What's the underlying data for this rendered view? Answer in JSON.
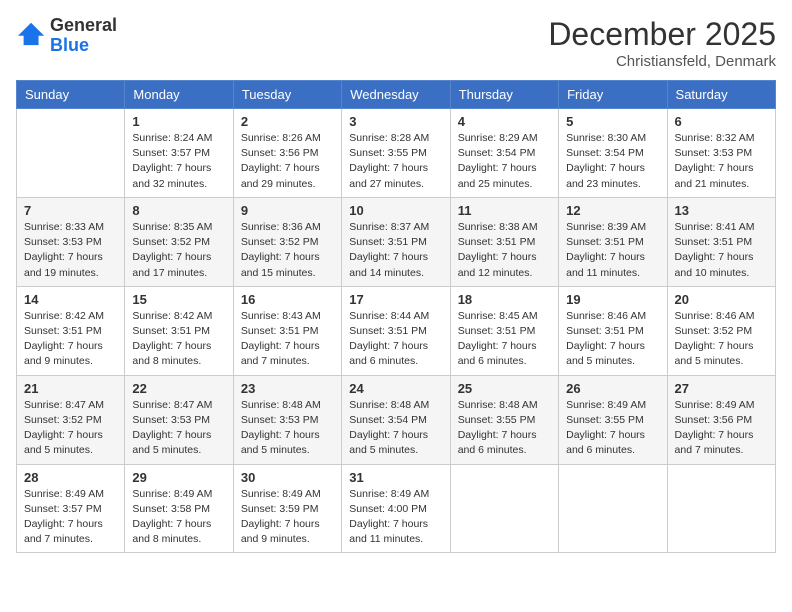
{
  "logo": {
    "general": "General",
    "blue": "Blue"
  },
  "title": "December 2025",
  "subtitle": "Christiansfeld, Denmark",
  "days_of_week": [
    "Sunday",
    "Monday",
    "Tuesday",
    "Wednesday",
    "Thursday",
    "Friday",
    "Saturday"
  ],
  "weeks": [
    [
      {
        "day": "",
        "info": ""
      },
      {
        "day": "1",
        "info": "Sunrise: 8:24 AM\nSunset: 3:57 PM\nDaylight: 7 hours\nand 32 minutes."
      },
      {
        "day": "2",
        "info": "Sunrise: 8:26 AM\nSunset: 3:56 PM\nDaylight: 7 hours\nand 29 minutes."
      },
      {
        "day": "3",
        "info": "Sunrise: 8:28 AM\nSunset: 3:55 PM\nDaylight: 7 hours\nand 27 minutes."
      },
      {
        "day": "4",
        "info": "Sunrise: 8:29 AM\nSunset: 3:54 PM\nDaylight: 7 hours\nand 25 minutes."
      },
      {
        "day": "5",
        "info": "Sunrise: 8:30 AM\nSunset: 3:54 PM\nDaylight: 7 hours\nand 23 minutes."
      },
      {
        "day": "6",
        "info": "Sunrise: 8:32 AM\nSunset: 3:53 PM\nDaylight: 7 hours\nand 21 minutes."
      }
    ],
    [
      {
        "day": "7",
        "info": "Sunrise: 8:33 AM\nSunset: 3:53 PM\nDaylight: 7 hours\nand 19 minutes."
      },
      {
        "day": "8",
        "info": "Sunrise: 8:35 AM\nSunset: 3:52 PM\nDaylight: 7 hours\nand 17 minutes."
      },
      {
        "day": "9",
        "info": "Sunrise: 8:36 AM\nSunset: 3:52 PM\nDaylight: 7 hours\nand 15 minutes."
      },
      {
        "day": "10",
        "info": "Sunrise: 8:37 AM\nSunset: 3:51 PM\nDaylight: 7 hours\nand 14 minutes."
      },
      {
        "day": "11",
        "info": "Sunrise: 8:38 AM\nSunset: 3:51 PM\nDaylight: 7 hours\nand 12 minutes."
      },
      {
        "day": "12",
        "info": "Sunrise: 8:39 AM\nSunset: 3:51 PM\nDaylight: 7 hours\nand 11 minutes."
      },
      {
        "day": "13",
        "info": "Sunrise: 8:41 AM\nSunset: 3:51 PM\nDaylight: 7 hours\nand 10 minutes."
      }
    ],
    [
      {
        "day": "14",
        "info": "Sunrise: 8:42 AM\nSunset: 3:51 PM\nDaylight: 7 hours\nand 9 minutes."
      },
      {
        "day": "15",
        "info": "Sunrise: 8:42 AM\nSunset: 3:51 PM\nDaylight: 7 hours\nand 8 minutes."
      },
      {
        "day": "16",
        "info": "Sunrise: 8:43 AM\nSunset: 3:51 PM\nDaylight: 7 hours\nand 7 minutes."
      },
      {
        "day": "17",
        "info": "Sunrise: 8:44 AM\nSunset: 3:51 PM\nDaylight: 7 hours\nand 6 minutes."
      },
      {
        "day": "18",
        "info": "Sunrise: 8:45 AM\nSunset: 3:51 PM\nDaylight: 7 hours\nand 6 minutes."
      },
      {
        "day": "19",
        "info": "Sunrise: 8:46 AM\nSunset: 3:51 PM\nDaylight: 7 hours\nand 5 minutes."
      },
      {
        "day": "20",
        "info": "Sunrise: 8:46 AM\nSunset: 3:52 PM\nDaylight: 7 hours\nand 5 minutes."
      }
    ],
    [
      {
        "day": "21",
        "info": "Sunrise: 8:47 AM\nSunset: 3:52 PM\nDaylight: 7 hours\nand 5 minutes."
      },
      {
        "day": "22",
        "info": "Sunrise: 8:47 AM\nSunset: 3:53 PM\nDaylight: 7 hours\nand 5 minutes."
      },
      {
        "day": "23",
        "info": "Sunrise: 8:48 AM\nSunset: 3:53 PM\nDaylight: 7 hours\nand 5 minutes."
      },
      {
        "day": "24",
        "info": "Sunrise: 8:48 AM\nSunset: 3:54 PM\nDaylight: 7 hours\nand 5 minutes."
      },
      {
        "day": "25",
        "info": "Sunrise: 8:48 AM\nSunset: 3:55 PM\nDaylight: 7 hours\nand 6 minutes."
      },
      {
        "day": "26",
        "info": "Sunrise: 8:49 AM\nSunset: 3:55 PM\nDaylight: 7 hours\nand 6 minutes."
      },
      {
        "day": "27",
        "info": "Sunrise: 8:49 AM\nSunset: 3:56 PM\nDaylight: 7 hours\nand 7 minutes."
      }
    ],
    [
      {
        "day": "28",
        "info": "Sunrise: 8:49 AM\nSunset: 3:57 PM\nDaylight: 7 hours\nand 7 minutes."
      },
      {
        "day": "29",
        "info": "Sunrise: 8:49 AM\nSunset: 3:58 PM\nDaylight: 7 hours\nand 8 minutes."
      },
      {
        "day": "30",
        "info": "Sunrise: 8:49 AM\nSunset: 3:59 PM\nDaylight: 7 hours\nand 9 minutes."
      },
      {
        "day": "31",
        "info": "Sunrise: 8:49 AM\nSunset: 4:00 PM\nDaylight: 7 hours\nand 11 minutes."
      },
      {
        "day": "",
        "info": ""
      },
      {
        "day": "",
        "info": ""
      },
      {
        "day": "",
        "info": ""
      }
    ]
  ]
}
